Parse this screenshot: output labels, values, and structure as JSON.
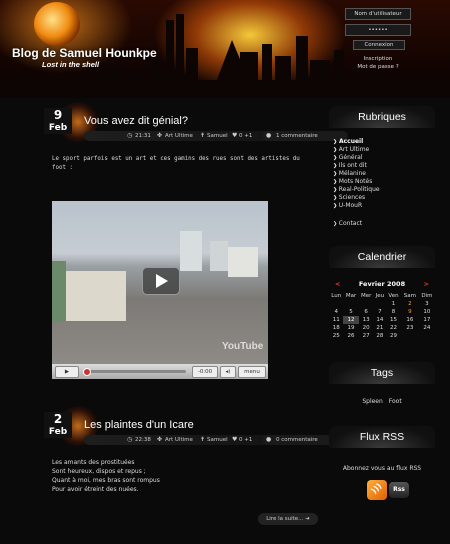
{
  "header": {
    "blog_title": "Blog de Samuel Hounkpe",
    "blog_subtitle": "Lost in the shell"
  },
  "login": {
    "username_placeholder": "Nom d'utilisateur",
    "password_value": "••••••",
    "submit_label": "Connexion",
    "register_link": "Inscription",
    "forgot_link": "Mot de passe ?"
  },
  "posts": [
    {
      "day": "9",
      "month": "Feb",
      "title": "Vous avez dit génial?",
      "time": "21:31",
      "category": "Art Ultime",
      "author": "Samuel",
      "votes": "0 +1",
      "comments": "1 commentaire",
      "excerpt": "Le sport parfois est un art et ces gamins des rues sont des artistes du foot :",
      "video": {
        "watermark": "YouTube",
        "time": "-0:00",
        "menu_label": "menu"
      }
    },
    {
      "day": "2",
      "month": "Feb",
      "title": "Les plaintes d'un Icare",
      "time": "22:38",
      "category": "Art Ultime",
      "author": "Samuel",
      "votes": "0 +1",
      "comments": "0 commentaire",
      "excerpt_lines": [
        "Les amants des prostituées",
        "Sont heureux, dispos et repus ;",
        "Quant à moi, mes bras sont rompus",
        "Pour avoir étreint des nuées."
      ],
      "read_more": "Lire la suite..."
    }
  ],
  "sidebar": {
    "rubriques_title": "Rubriques",
    "categories": [
      "Accueil",
      "Art Ultime",
      "Général",
      "Ils ont dit",
      "Mélanine",
      "Mots Notés",
      "Real-Politique",
      "Sciences",
      "U-MouR"
    ],
    "contact": "Contact",
    "calendar_title": "Calendrier",
    "calendar": {
      "month_label": "Fevrier 2008",
      "prev": "<",
      "next": ">",
      "weekdays": [
        "Lun",
        "Mar",
        "Mer",
        "Jeu",
        "Ven",
        "Sam",
        "Dim"
      ],
      "weeks": [
        [
          "",
          "",
          "",
          "",
          "1",
          "2",
          "3"
        ],
        [
          "4",
          "5",
          "6",
          "7",
          "8",
          "9",
          "10"
        ],
        [
          "11",
          "12",
          "13",
          "14",
          "15",
          "16",
          "17"
        ],
        [
          "18",
          "19",
          "20",
          "21",
          "22",
          "23",
          "24"
        ],
        [
          "25",
          "26",
          "27",
          "28",
          "29",
          "",
          ""
        ]
      ],
      "linked_days": [
        "2",
        "9"
      ],
      "today": "12"
    },
    "tags_title": "Tags",
    "tags": [
      "Spleen",
      "Foot"
    ],
    "rss_title": "Flux RSS",
    "rss_text": "Abonnez vous au flux RSS",
    "rss_badge": "Rss"
  }
}
